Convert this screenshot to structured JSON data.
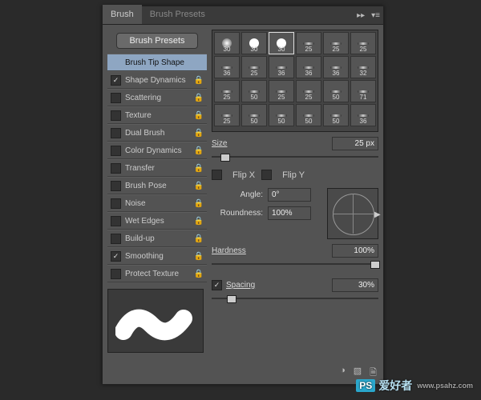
{
  "tabs": {
    "brush": "Brush",
    "presets": "Brush Presets"
  },
  "presets_button": "Brush Presets",
  "options": [
    {
      "label": "Brush Tip Shape",
      "checkbox": null,
      "locked": false,
      "selected": true
    },
    {
      "label": "Shape Dynamics",
      "checkbox": true,
      "locked": true
    },
    {
      "label": "Scattering",
      "checkbox": false,
      "locked": true
    },
    {
      "label": "Texture",
      "checkbox": false,
      "locked": true
    },
    {
      "label": "Dual Brush",
      "checkbox": false,
      "locked": true
    },
    {
      "label": "Color Dynamics",
      "checkbox": false,
      "locked": true
    },
    {
      "label": "Transfer",
      "checkbox": false,
      "locked": true
    },
    {
      "label": "Brush Pose",
      "checkbox": false,
      "locked": true
    },
    {
      "label": "Noise",
      "checkbox": false,
      "locked": true
    },
    {
      "label": "Wet Edges",
      "checkbox": false,
      "locked": true
    },
    {
      "label": "Build-up",
      "checkbox": false,
      "locked": true
    },
    {
      "label": "Smoothing",
      "checkbox": true,
      "locked": true
    },
    {
      "label": "Protect Texture",
      "checkbox": false,
      "locked": true
    }
  ],
  "thumbs_rows": [
    [
      "30",
      "30",
      "30",
      "25",
      "25",
      "25"
    ],
    [
      "36",
      "25",
      "36",
      "36",
      "36",
      "32"
    ],
    [
      "25",
      "50",
      "25",
      "25",
      "50",
      "71"
    ],
    [
      "25",
      "50",
      "50",
      "50",
      "50",
      "36"
    ]
  ],
  "fields": {
    "size_label": "Size",
    "size_value": "25 px",
    "flipx": "Flip X",
    "flipy": "Flip Y",
    "angle_label": "Angle:",
    "angle_value": "0°",
    "round_label": "Roundness:",
    "round_value": "100%",
    "hard_label": "Hardness",
    "hard_value": "100%",
    "spacing_label": "Spacing",
    "spacing_value": "30%"
  },
  "watermark": {
    "ps": "PS",
    "txt": "爱好者",
    "url": "www.psahz.com"
  }
}
